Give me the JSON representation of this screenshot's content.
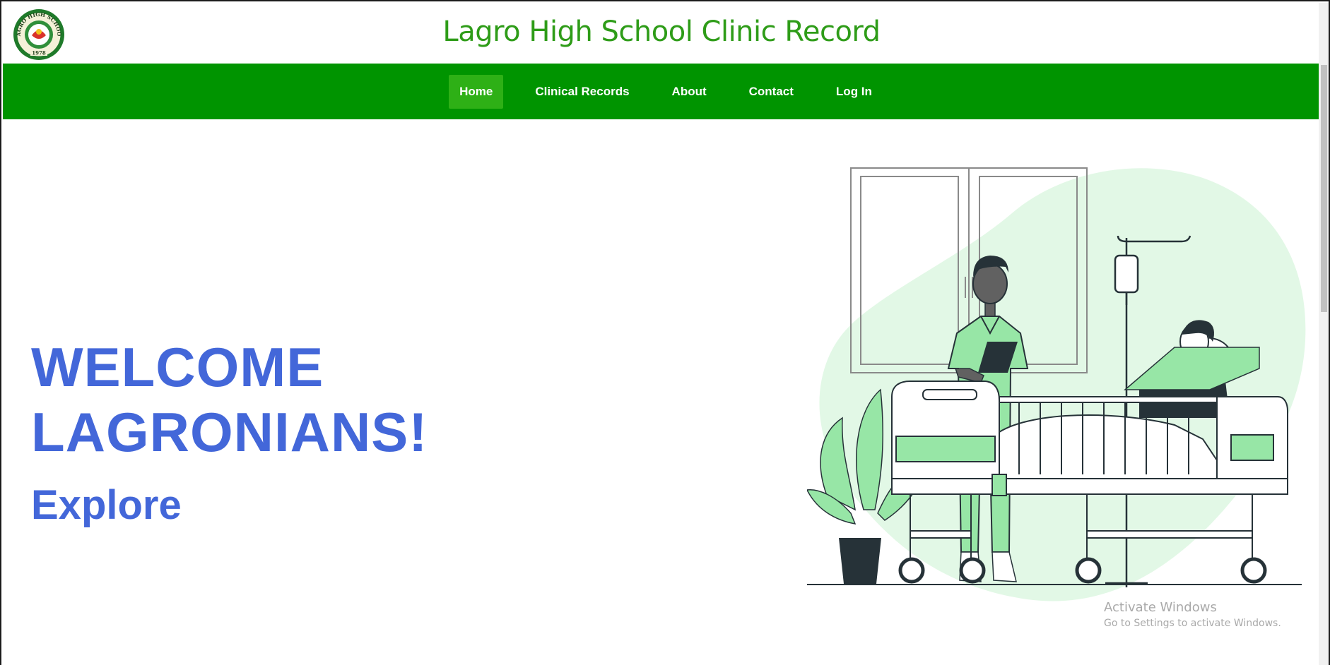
{
  "header": {
    "title": "Lagro High School Clinic Record",
    "logo_text_top": "LAGRO HIGH SCHOOL",
    "logo_year": "1978"
  },
  "nav": {
    "items": [
      {
        "label": "Home",
        "active": true
      },
      {
        "label": "Clinical Records",
        "active": false
      },
      {
        "label": "About",
        "active": false
      },
      {
        "label": "Contact",
        "active": false
      },
      {
        "label": "Log In",
        "active": false
      }
    ]
  },
  "hero": {
    "line1": "WELCOME",
    "line2": "LAGRONIANS!",
    "explore": "Explore"
  },
  "watermark": {
    "title": "Activate Windows",
    "subtitle": "Go to Settings to activate Windows."
  },
  "colors": {
    "nav_bg": "#009400",
    "nav_active": "#2eb016",
    "title_green": "#2e9c18",
    "hero_blue": "#4367d9",
    "illustration_green": "#97e6a6",
    "illustration_blob": "#e2f8e6"
  }
}
